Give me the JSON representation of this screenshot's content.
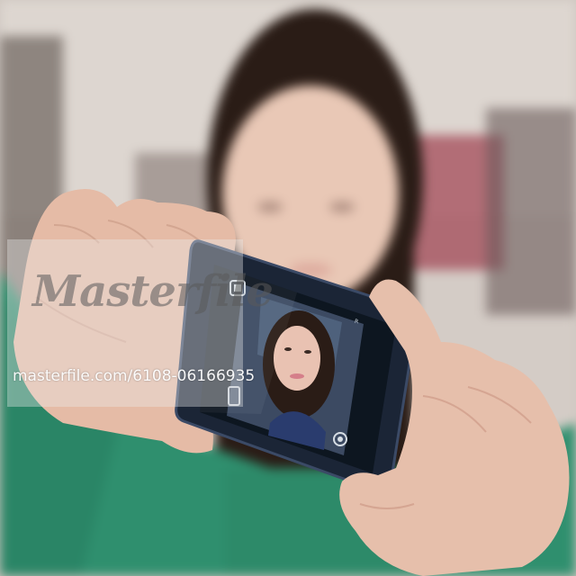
{
  "image": {
    "subject": "photo",
    "colors": {
      "background": "#cfc7c0",
      "sweater": "#2f8f6e",
      "skin": "#e7c2ae",
      "hair": "#2a1c16",
      "phone_body": "#1b2536",
      "phone_screen": "#0d1620"
    }
  },
  "watermark": {
    "logo_text": "Masterfile",
    "image_id": "masterfile.com/6108-06166935"
  },
  "phone": {
    "status_text": "R",
    "icons": [
      "camera-mode-icon",
      "shutter-icon",
      "settings-icon"
    ]
  }
}
